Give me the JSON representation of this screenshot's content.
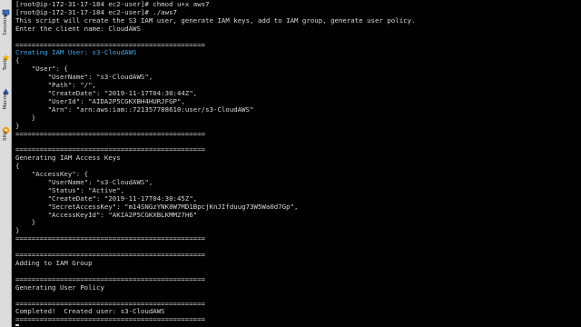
{
  "sidebar": {
    "items": [
      {
        "label": "Sessions",
        "icon": "sessions-icon"
      },
      {
        "label": "Tools",
        "icon": "tools-icon"
      },
      {
        "label": "Macros",
        "icon": "macros-icon"
      },
      {
        "label": "Sftp",
        "icon": "sftp-icon"
      }
    ]
  },
  "terminal": {
    "lines": [
      "[root@ip-172-31-17-184 ec2-user]# chmod u+x aws7",
      "[root@ip-172-31-17-184 ec2-user]# ./aws7",
      "This script will create the S3 IAM user, generate IAM keys, add to IAM group, generate user policy.",
      "Enter the client name: CloudAWS",
      "",
      "===============================================",
      "Creating IAM User: s3-CloudAWS",
      "{",
      "    \"User\": {",
      "        \"UserName\": \"s3-CloudAWS\",",
      "        \"Path\": \"/\",",
      "        \"CreateDate\": \"2019-11-17T04:30:44Z\",",
      "        \"UserId\": \"AIDA2P5CGKXBH4HURJFGP\",",
      "        \"Arn\": \"arn:aws:iam::721357788610:user/s3-CloudAWS\"",
      "    }",
      "}",
      "===============================================",
      "",
      "===============================================",
      "Generating IAM Access Keys",
      "{",
      "    \"AccessKey\": {",
      "        \"UserName\": \"s3-CloudAWS\",",
      "        \"Status\": \"Active\",",
      "        \"CreateDate\": \"2019-11-17T04:30:45Z\",",
      "        \"SecretAccessKey\": \"m14SNGzYNK0W7MD1BpcjKnJIfduug73W5Wa0d7Gp\",",
      "        \"AccessKeyId\": \"AKIA2P5CGKXBLKMM27H6\"",
      "    }",
      "}",
      "===============================================",
      "",
      "===============================================",
      "Adding to IAM Group",
      "",
      "===============================================",
      "Generating User Policy",
      "",
      "===============================================",
      "Completed!  Created user: s3-CloudAWS",
      "==============================================="
    ],
    "highlight_line": 6,
    "highlight_color": "#3fa8e8",
    "text_color": "#d8d8d8",
    "background": "#000000"
  },
  "colors": {
    "sidebar_bg": "#dcdcdc",
    "star": "#f0b400",
    "sftp": "#f39c12",
    "sessions": "#3b6fb6",
    "macros": "#2f5f9e"
  }
}
